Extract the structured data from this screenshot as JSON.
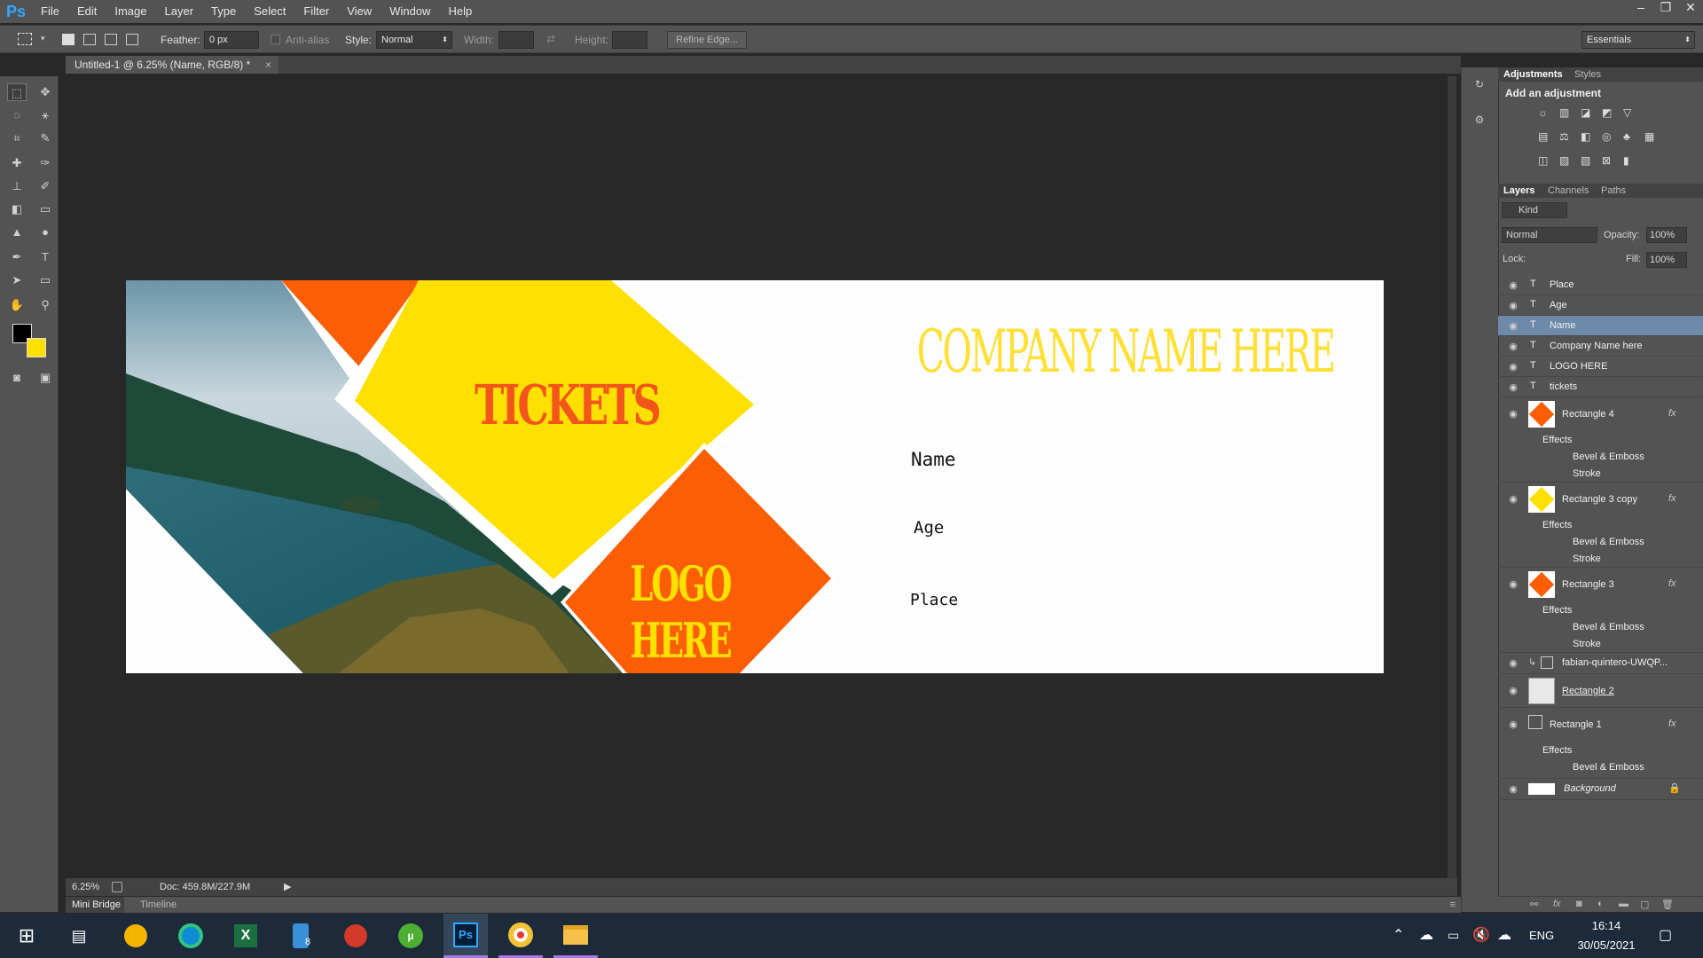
{
  "app": {
    "logo": "Ps",
    "window_controls": [
      "–",
      "❐",
      "✕"
    ]
  },
  "menu": [
    "File",
    "Edit",
    "Image",
    "Layer",
    "Type",
    "Select",
    "Filter",
    "View",
    "Window",
    "Help"
  ],
  "options_bar": {
    "feather_label": "Feather:",
    "feather_value": "0 px",
    "antialias_label": "Anti-alias",
    "style_label": "Style:",
    "style_value": "Normal",
    "width_label": "Width:",
    "height_label": "Height:",
    "refine_edge": "Refine Edge...",
    "workspace": "Essentials"
  },
  "document": {
    "tab_title": "Untitled-1 @ 6.25% (Name, RGB/8) *",
    "tab_close": "×"
  },
  "artboard": {
    "tickets": "TICKETS",
    "logo": "LOGO HERE",
    "company": "COMPANY NAME HERE",
    "name_label": "Name",
    "age_label": "Age",
    "place_label": "Place",
    "colors": {
      "yellow": "#ffe000",
      "orange": "#fc5e06",
      "tickets_text": "#f2561a",
      "logo_text": "#ffe100",
      "company_text": "#ffe033"
    }
  },
  "status": {
    "zoom": "6.25%",
    "doc": "Doc: 459.8M/227.9M"
  },
  "bottom_tabs": [
    "Mini Bridge",
    "Timeline"
  ],
  "adjustments_panel": {
    "tabs": [
      "Adjustments",
      "Styles"
    ],
    "heading": "Add an adjustment"
  },
  "layers_panel": {
    "tabs": [
      "Layers",
      "Channels",
      "Paths"
    ],
    "kind": "Kind",
    "blend_mode": "Normal",
    "opacity_label": "Opacity:",
    "opacity": "100%",
    "lock_label": "Lock:",
    "fill_label": "Fill:",
    "fill": "100%",
    "effects_label": "Effects",
    "bevel_label": "Bevel & Emboss",
    "stroke_label": "Stroke",
    "text_layers": [
      "Place",
      "Age",
      "Name",
      "Company Name here",
      "LOGO HERE",
      "tickets"
    ],
    "rect4": "Rectangle 4",
    "rect3copy": "Rectangle 3 copy",
    "rect3": "Rectangle 3",
    "photo": "fabian-quintero-UWQP...",
    "rect2": "Rectangle 2",
    "rect1": "Rectangle 1",
    "background": "Background"
  },
  "taskbar": {
    "language": "ENG",
    "time": "16:14",
    "date": "30/05/2021",
    "badge": "8"
  }
}
